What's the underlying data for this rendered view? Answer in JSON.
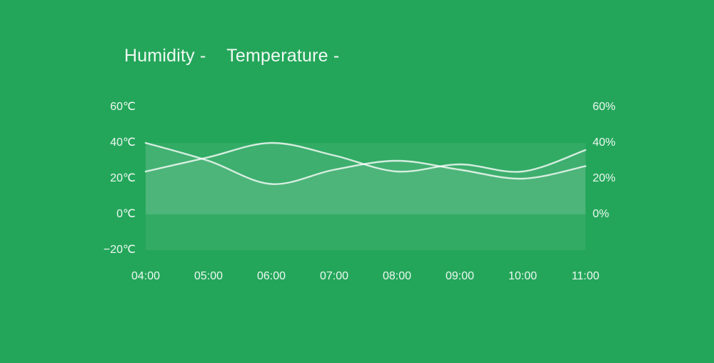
{
  "legend": {
    "humidity_label": "Humidity -",
    "temperature_label": "Temperature -"
  },
  "axes": {
    "y_left_ticks": [
      "60℃",
      "40℃",
      "20℃",
      "0℃",
      "−20℃"
    ],
    "y_left_values": [
      60,
      40,
      20,
      0,
      -20
    ],
    "y_right_ticks": [
      "60%",
      "40%",
      "20%",
      "0%"
    ],
    "y_right_values": [
      60,
      40,
      20,
      0
    ],
    "x_ticks": [
      "04:00",
      "05:00",
      "06:00",
      "07:00",
      "08:00",
      "09:00",
      "10:00",
      "11:00"
    ]
  },
  "chart_data": {
    "type": "line",
    "x": [
      "04:00",
      "05:00",
      "06:00",
      "07:00",
      "08:00",
      "09:00",
      "10:00",
      "11:00"
    ],
    "series": [
      {
        "name": "Humidity",
        "values_pct": [
          40,
          30,
          17,
          25,
          30,
          25,
          20,
          27
        ],
        "y_axis": "right"
      },
      {
        "name": "Temperature",
        "values_c": [
          24,
          32,
          40,
          33,
          24,
          28,
          24,
          36
        ],
        "y_axis": "left"
      }
    ],
    "y_left": {
      "label": "",
      "min": -20,
      "max": 60,
      "unit": "℃"
    },
    "y_right": {
      "label": "",
      "min": 0,
      "max": 60,
      "unit": "%"
    },
    "title": "",
    "xlabel": "",
    "grid": false
  },
  "colors": {
    "bg": "#24a65a",
    "line": "rgba(255,255,255,0.78)",
    "fill": "rgba(255,255,255,0.07)"
  }
}
